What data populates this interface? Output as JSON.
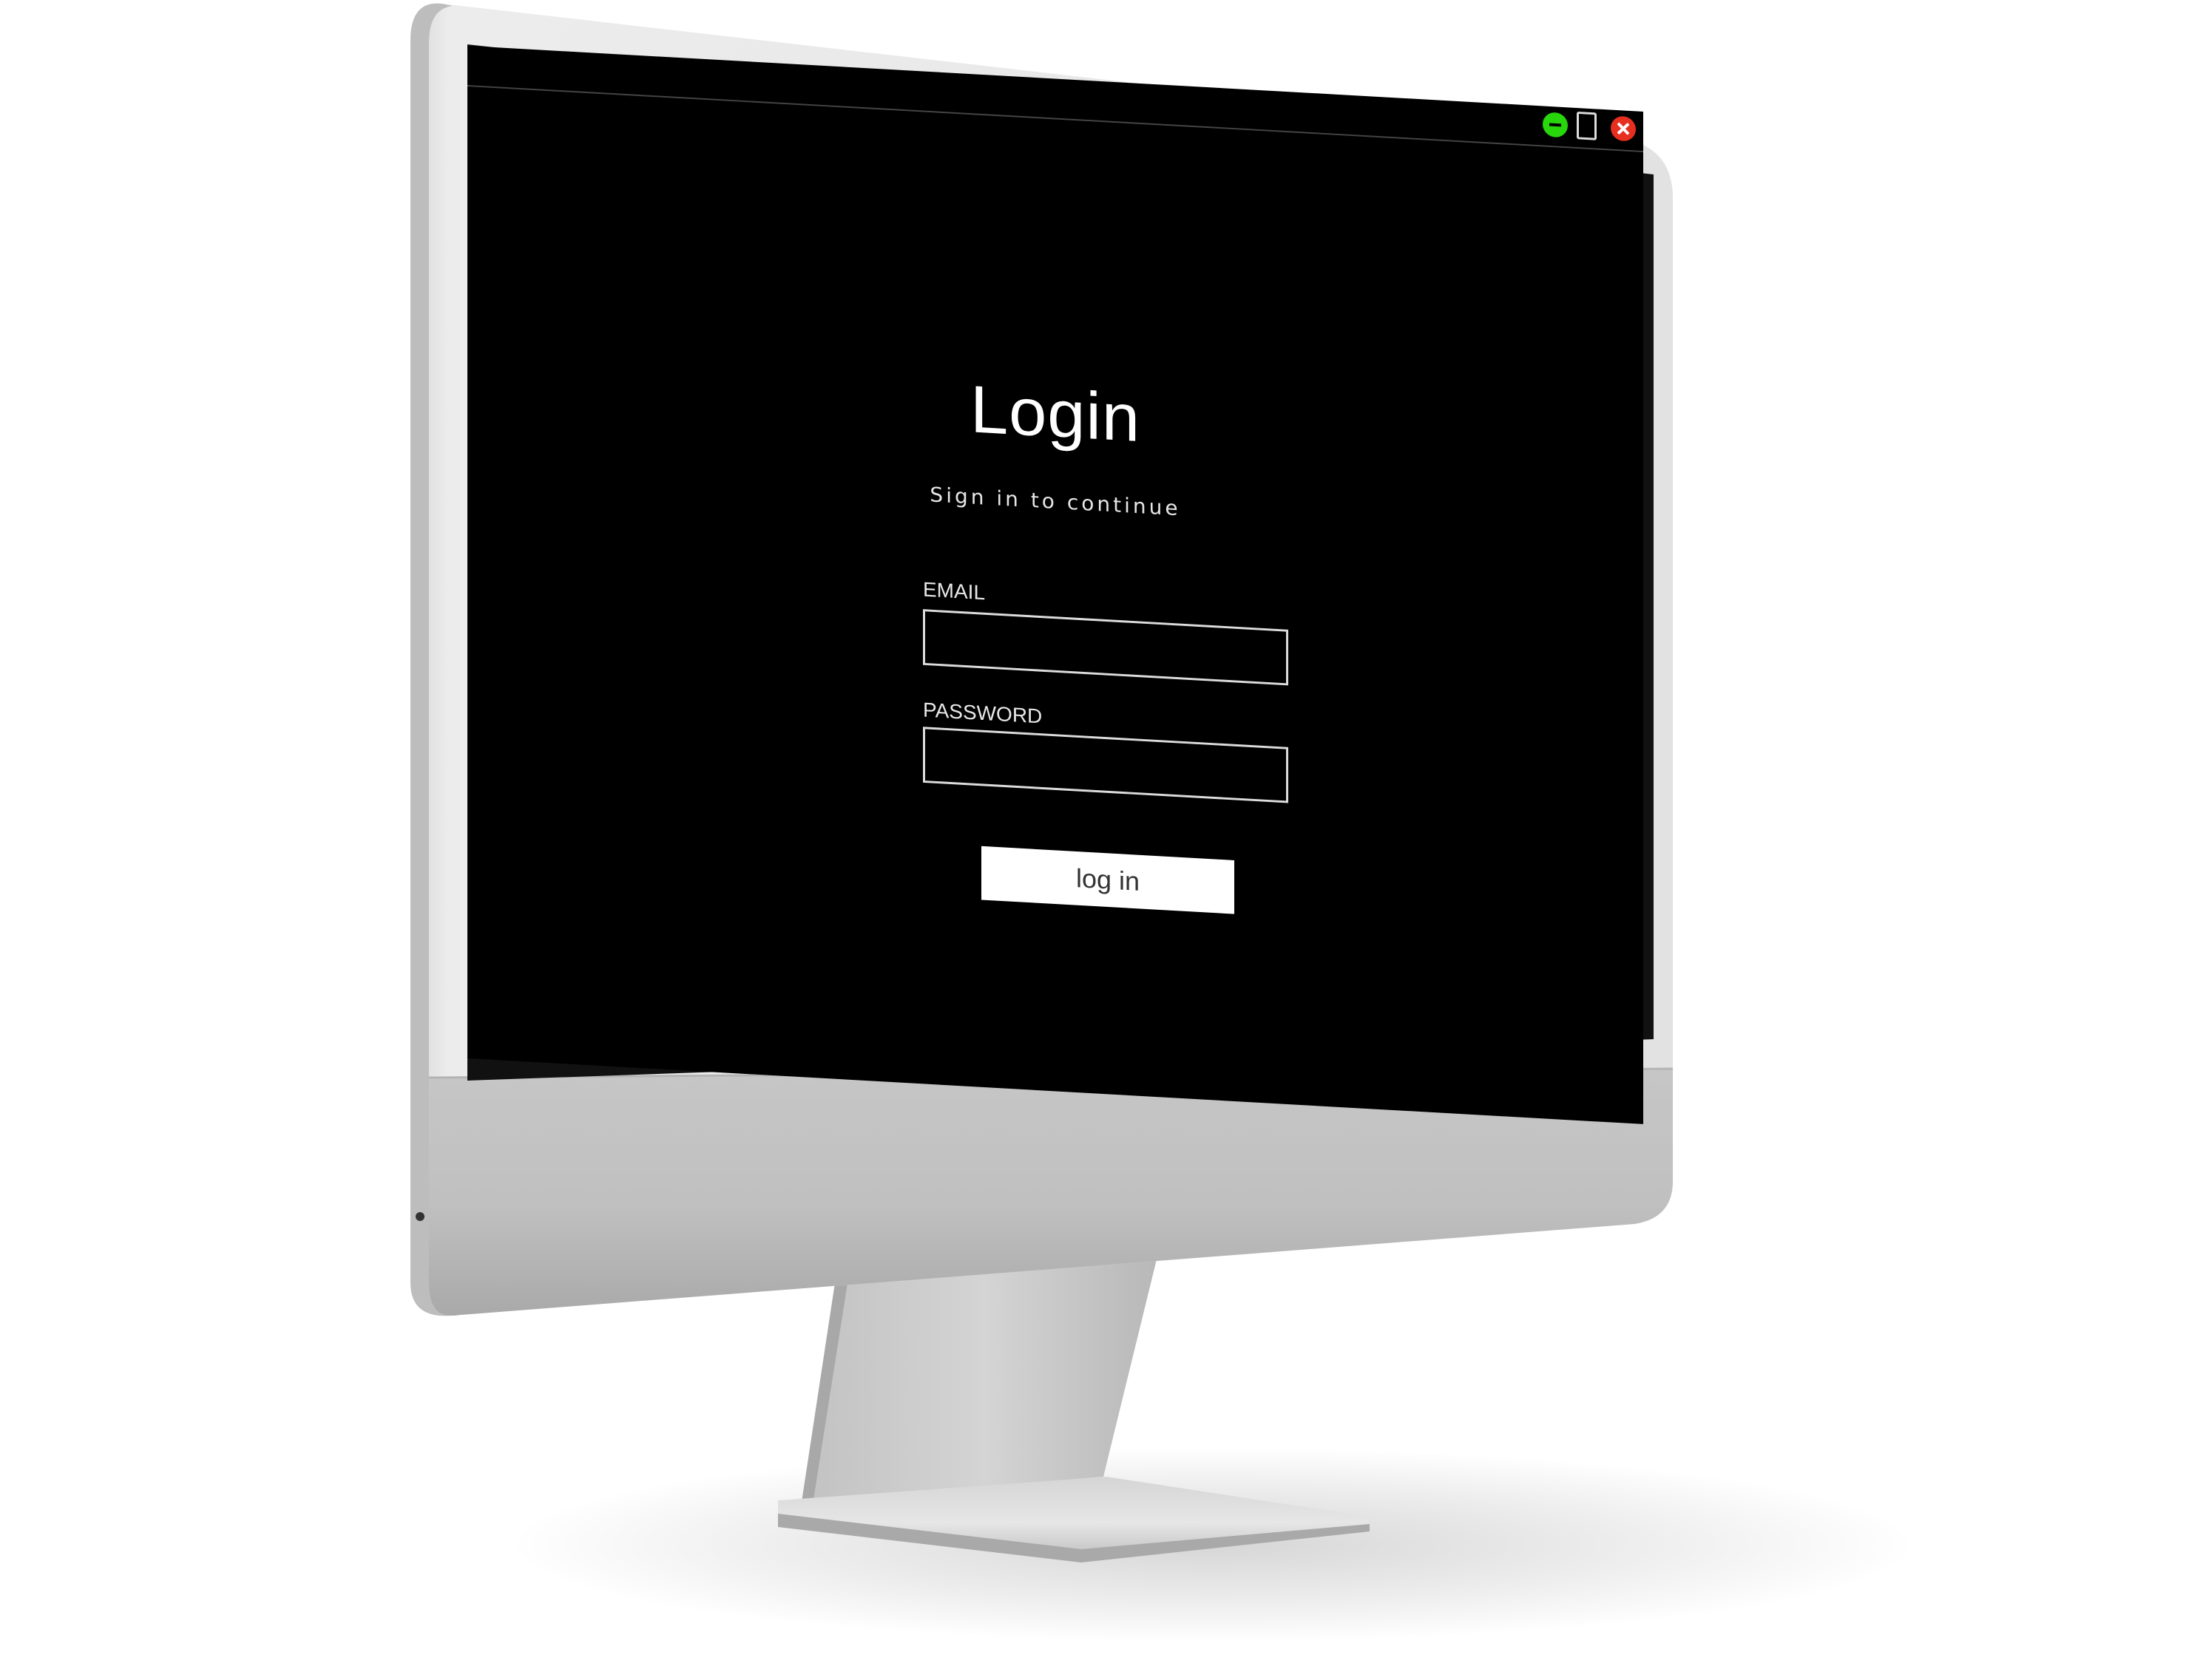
{
  "window": {
    "title": "",
    "controls": {
      "minimize_icon": "minimize-icon",
      "maximize_icon": "maximize-icon",
      "close_icon": "close-icon"
    }
  },
  "login": {
    "title": "Login",
    "subtitle": "Sign in to continue",
    "email_label": "EMAIL",
    "email_value": "",
    "email_placeholder": "",
    "password_label": "PASSWORD",
    "password_value": "",
    "password_placeholder": "",
    "button_label": "log in"
  },
  "colors": {
    "screen_background": "#000000",
    "minimize": "#27d60b",
    "close": "#e72f20",
    "device_silver": "#c9c9c9"
  }
}
